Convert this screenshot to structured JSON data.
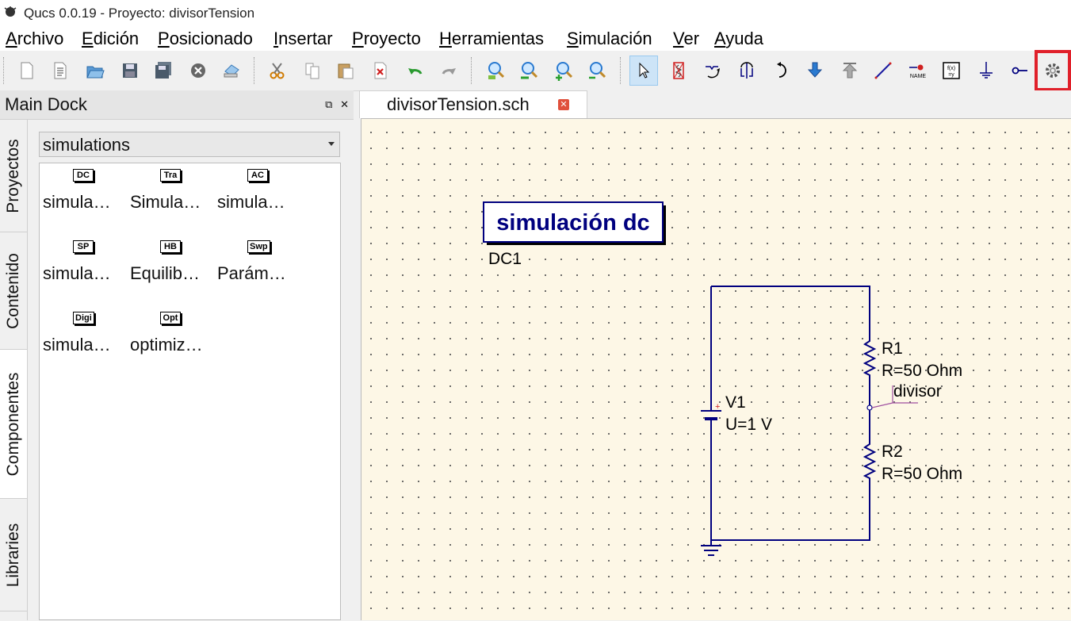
{
  "window": {
    "title": "Qucs 0.0.19 - Proyecto: divisorTension"
  },
  "menu": [
    "Archivo",
    "Edición",
    "Posicionado",
    "Insertar",
    "Proyecto",
    "Herramientas",
    "Simulación",
    "Ver",
    "Ayuda"
  ],
  "toolbar": {
    "buttons": [
      "new-file-icon",
      "new-text-icon",
      "open-icon",
      "save-icon",
      "save-all-icon",
      "close-file-icon",
      "print-icon",
      "cut-icon",
      "copy-icon",
      "paste-icon",
      "delete-icon",
      "undo-icon",
      "redo-icon",
      "zoom-fit-icon",
      "zoom-one-icon",
      "zoom-in-icon",
      "zoom-out-icon",
      "select-icon",
      "deactivate-icon",
      "rotate-icon",
      "mirror-x-icon",
      "mirror-y-icon",
      "enter-subcircuit-icon",
      "exit-subcircuit-icon",
      "wire-icon",
      "label-icon",
      "equation-icon",
      "ground-icon",
      "port-icon",
      "simulate-icon"
    ],
    "highlighted": "simulate-icon"
  },
  "dock": {
    "title": "Main Dock",
    "tabs": [
      "Proyectos",
      "Contenido",
      "Componentes",
      "Libraries"
    ],
    "active_tab": "Componentes",
    "category": "simulations",
    "components": [
      {
        "icon": "DC",
        "label": "simula…"
      },
      {
        "icon": "Tra",
        "label": "Simula…"
      },
      {
        "icon": "AC",
        "label": "simula…"
      },
      {
        "icon": "SP",
        "label": "simula…"
      },
      {
        "icon": "HB",
        "label": "Equilib…"
      },
      {
        "icon": "Swp",
        "label": "Parám…"
      },
      {
        "icon": "Digi",
        "label": "simula…"
      },
      {
        "icon": "Opt",
        "label": "optimiz…"
      }
    ]
  },
  "document": {
    "tab": "divisorTension.sch",
    "sim_block": {
      "title": "simulación dc",
      "name": "DC1"
    },
    "v1": {
      "name": "V1",
      "value": "U=1 V",
      "plus": "+"
    },
    "r1": {
      "name": "R1",
      "value": "R=50 Ohm"
    },
    "r2": {
      "name": "R2",
      "value": "R=50 Ohm"
    },
    "node_label": "divisor"
  },
  "colors": {
    "wire": "#00007f",
    "canvas": "#fdf7e6",
    "highlight": "#e0202a",
    "label": "#000000"
  }
}
